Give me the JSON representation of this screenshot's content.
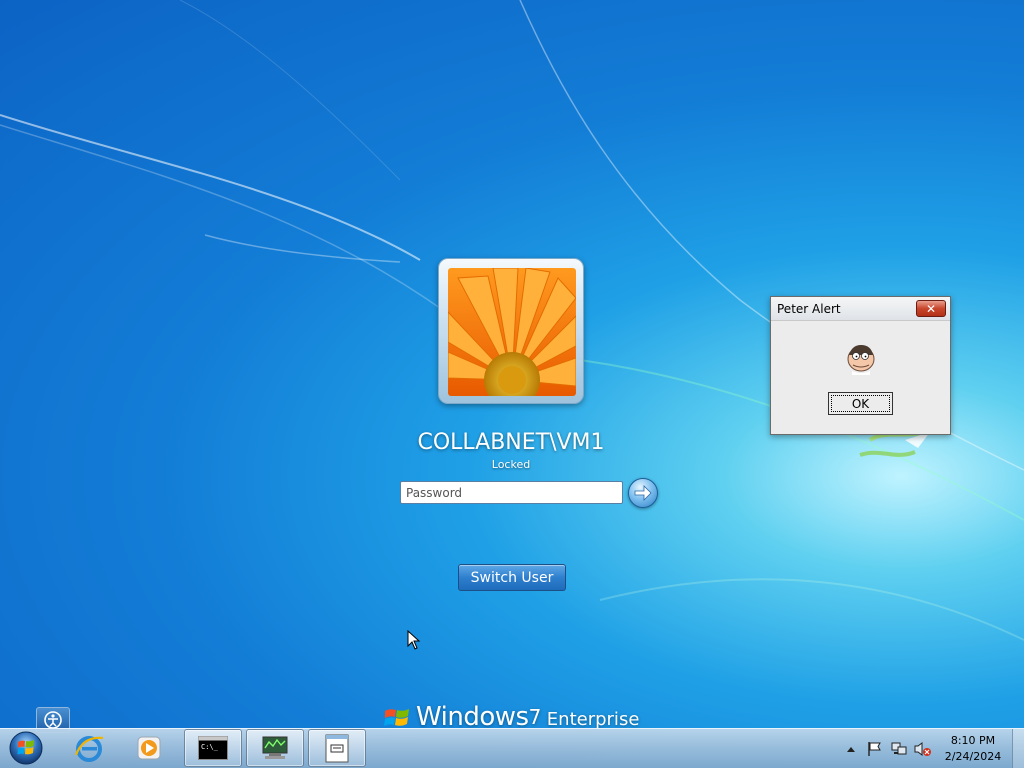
{
  "logon": {
    "user_name": "COLLABNET\\VM1",
    "status": "Locked",
    "password_placeholder": "Password",
    "submit_icon": "arrow-right-icon",
    "switch_user_label": "Switch User",
    "avatar_icon": "orange-flower-avatar"
  },
  "branding": {
    "os_name": "Windows",
    "version": "7",
    "edition": "Enterprise"
  },
  "alert": {
    "title": "Peter Alert",
    "ok_label": "OK",
    "close_label": "✕",
    "icon": "cartoon-face-icon"
  },
  "taskbar": {
    "pinned": [
      "start-orb-icon",
      "internet-explorer-icon",
      "media-player-icon"
    ],
    "open_apps": [
      "command-prompt-icon",
      "network-monitor-icon",
      "notepad-icon"
    ],
    "tray_icons": [
      "show-hidden-arrow-icon",
      "action-center-flag-icon",
      "network-icon",
      "volume-muted-icon"
    ],
    "clock_time": "8:10 PM",
    "clock_date": "2/24/2024"
  },
  "colors": {
    "background_dark": "#0c63c4",
    "background_light": "#5fd0f0",
    "close_button": "#c9462d"
  }
}
